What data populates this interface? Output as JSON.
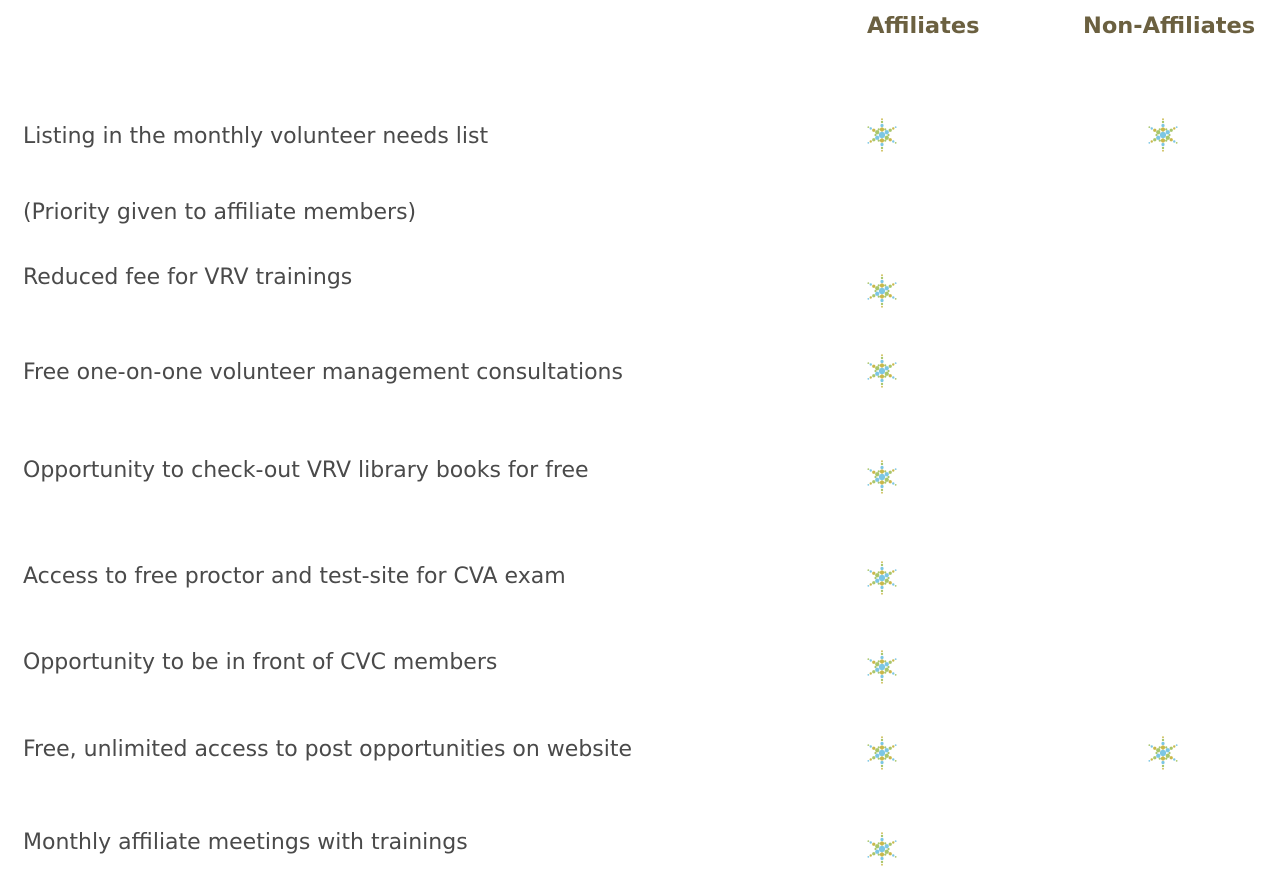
{
  "header": {
    "affiliates": "Affiliates",
    "non_affiliates": "Non-Affiliates"
  },
  "icon": "sparkle-check-icon",
  "colors": {
    "header_text": "#6b6040",
    "body_text": "#4a4a4a",
    "icon_blue": "#7cc6e4",
    "icon_gold": "#c9b84a",
    "icon_green": "#a8c66c"
  },
  "rows": [
    {
      "label": "Listing in the monthly volunteer needs list",
      "affiliates": true,
      "non_affiliates": true
    },
    {
      "label": "(Priority given to affiliate members)",
      "affiliates": false,
      "non_affiliates": false
    },
    {
      "label": "Reduced fee for VRV trainings",
      "affiliates": true,
      "non_affiliates": false
    },
    {
      "label": "Free one-on-one volunteer management consultations",
      "affiliates": true,
      "non_affiliates": false
    },
    {
      "label": "Opportunity to check-out VRV library books for free",
      "affiliates": true,
      "non_affiliates": false
    },
    {
      "label": "Access to free proctor and test-site for CVA exam",
      "affiliates": true,
      "non_affiliates": false
    },
    {
      "label": "Opportunity to be in front of CVC members",
      "affiliates": true,
      "non_affiliates": false
    },
    {
      "label": "Free, unlimited access to post opportunities on website",
      "affiliates": true,
      "non_affiliates": true
    },
    {
      "label": "Monthly affiliate meetings with trainings",
      "affiliates": true,
      "non_affiliates": false
    }
  ]
}
